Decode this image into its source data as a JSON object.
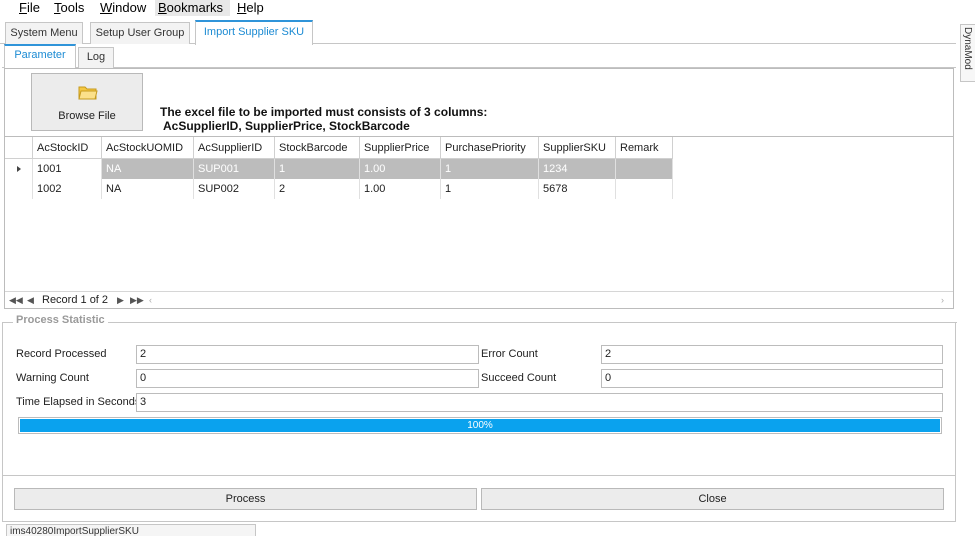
{
  "menu": {
    "file": {
      "key": "F",
      "rest": "ile"
    },
    "tools": {
      "key": "T",
      "rest": "ools"
    },
    "window": {
      "key": "W",
      "rest": "indow"
    },
    "bookmarks": {
      "key": "B",
      "rest": "ookmarks"
    },
    "help": {
      "key": "H",
      "rest": "elp"
    }
  },
  "tabs": [
    "System Menu",
    "Setup User Group",
    "Import Supplier SKU"
  ],
  "side_tab": "DynaMod",
  "subtabs": [
    "Parameter",
    "Log"
  ],
  "browse_button": "Browse File",
  "instructions": {
    "line1": "The excel file to be imported must consists of 3 columns:",
    "line2": "AcSupplierID, SupplierPrice, StockBarcode"
  },
  "grid": {
    "columns": [
      "AcStockID",
      "AcStockUOMID",
      "AcSupplierID",
      "StockBarcode",
      "SupplierPrice",
      "PurchasePriority",
      "SupplierSKU",
      "Remark"
    ],
    "rows": [
      [
        "1001",
        "NA",
        "SUP001",
        "1",
        "1.00",
        "1",
        "1234",
        ""
      ],
      [
        "1002",
        "NA",
        "SUP002",
        "2",
        "1.00",
        "1",
        "5678",
        ""
      ]
    ],
    "selected_row": 0,
    "navigator": "Record 1 of 2"
  },
  "stats": {
    "title": "Process Statistic",
    "record_processed_label": "Record Processed",
    "record_processed": "2",
    "error_count_label": "Error Count",
    "error_count": "2",
    "warning_count_label": "Warning Count",
    "warning_count": "0",
    "succeed_count_label": "Succeed Count",
    "succeed_count": "0",
    "time_elapsed_label": "Time Elapsed in Seconds",
    "time_elapsed": "3",
    "progress_label": "100%",
    "progress_value": 1.0
  },
  "buttons": {
    "process": "Process",
    "close": "Close"
  },
  "status_tab": "ims40280ImportSupplierSKU",
  "colors": {
    "accent": "#2f94d9",
    "progress": "#0aa2ee",
    "selected_row": "#bcbcbc"
  }
}
